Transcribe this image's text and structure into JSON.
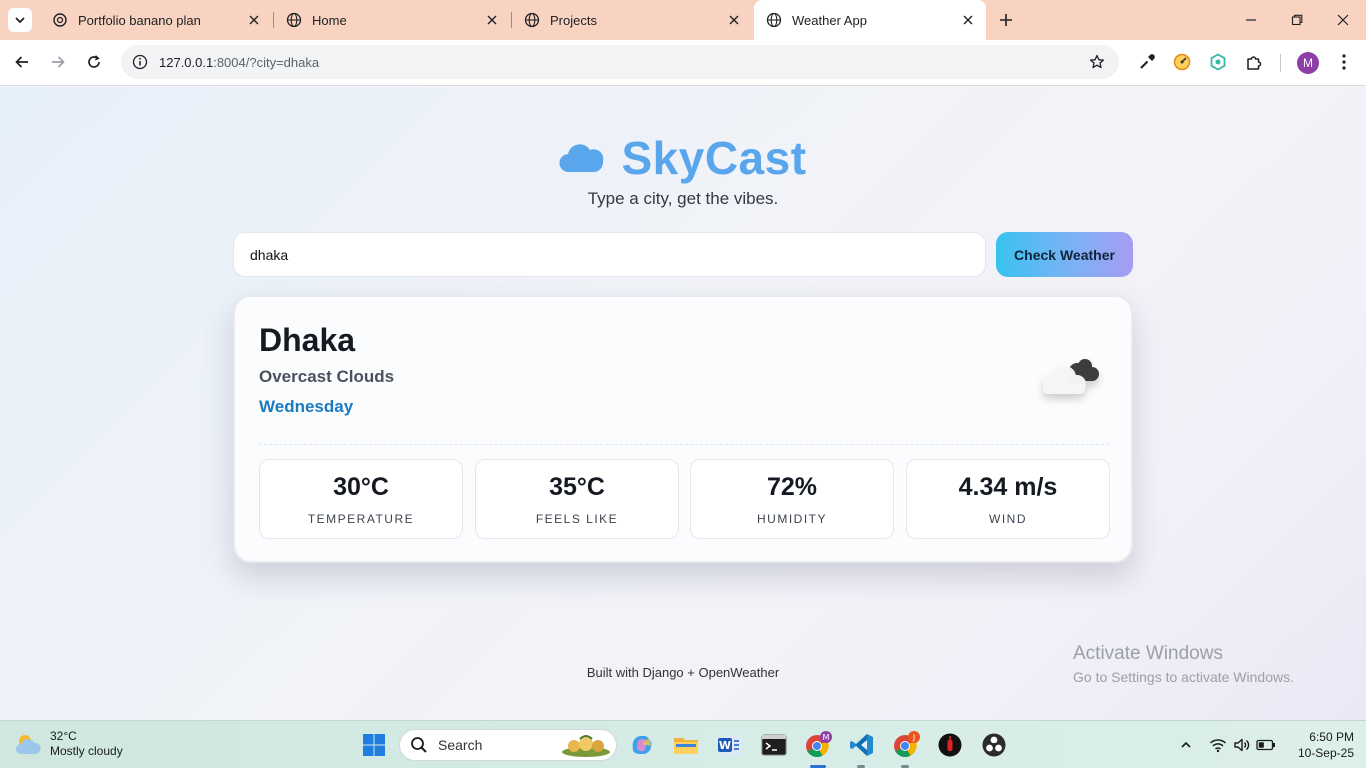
{
  "browser": {
    "tabs": [
      {
        "label": "Portfolio banano plan",
        "icon": "chatgpt-icon"
      },
      {
        "label": "Home",
        "icon": "globe-icon"
      },
      {
        "label": "Projects",
        "icon": "globe-icon"
      },
      {
        "label": "Weather App",
        "icon": "globe-icon",
        "active": true
      }
    ],
    "url_host": "127.0.0.1",
    "url_rest": ":8004/?city=dhaka",
    "profile_initial": "M"
  },
  "app": {
    "brand": "SkyCast",
    "tagline": "Type a city, get the vibes.",
    "search_value": "dhaka",
    "button_label": "Check Weather",
    "city": "Dhaka",
    "condition": "Overcast Clouds",
    "day": "Wednesday",
    "stats": [
      {
        "value": "30°C",
        "label": "TEMPERATURE"
      },
      {
        "value": "35°C",
        "label": "FEELS LIKE"
      },
      {
        "value": "72%",
        "label": "HUMIDITY"
      },
      {
        "value": "4.34 m/s",
        "label": "WIND"
      }
    ],
    "footer": "Built with Django + OpenWeather"
  },
  "watermark": {
    "line1": "Activate Windows",
    "line2": "Go to Settings to activate Windows."
  },
  "taskbar": {
    "weather_temp": "32°C",
    "weather_desc": "Mostly cloudy",
    "search_placeholder": "Search",
    "time": "6:50 PM",
    "date": "10-Sep-25",
    "chrome_badge_1": "M",
    "chrome_badge_2": "J"
  },
  "colors": {
    "brand": "#5aa6ec",
    "day": "#1a7bc2",
    "tabstrip": "#f8d3c2"
  }
}
